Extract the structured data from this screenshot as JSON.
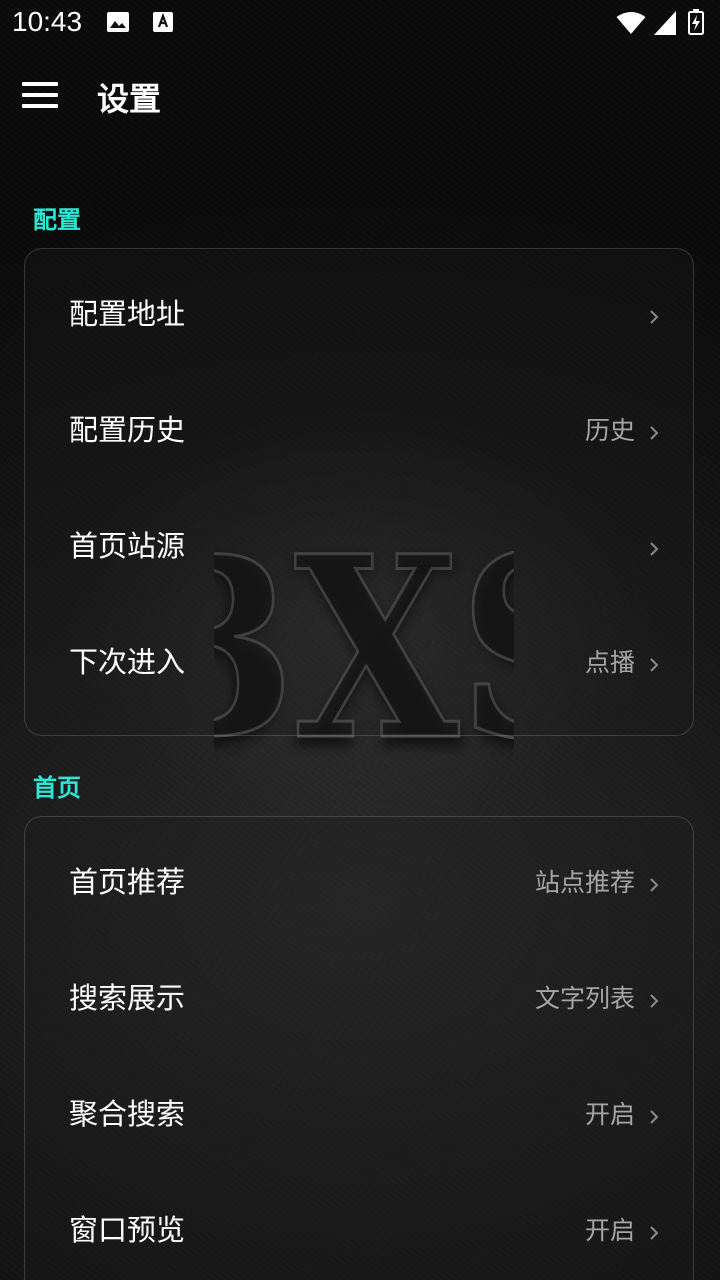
{
  "status_bar": {
    "time": "10:43",
    "icons": [
      "gallery-icon",
      "a-icon",
      "wifi-icon",
      "signal-icon",
      "battery-charging-icon"
    ]
  },
  "app_bar": {
    "menu_icon": "menu-icon",
    "title": "设置"
  },
  "watermark": {
    "text": "BXS"
  },
  "sections": [
    {
      "title": "配置",
      "items": [
        {
          "label": "配置地址",
          "value": ""
        },
        {
          "label": "配置历史",
          "value": "历史"
        },
        {
          "label": "首页站源",
          "value": ""
        },
        {
          "label": "下次进入",
          "value": "点播"
        }
      ]
    },
    {
      "title": "首页",
      "items": [
        {
          "label": "首页推荐",
          "value": "站点推荐"
        },
        {
          "label": "搜索展示",
          "value": "文字列表"
        },
        {
          "label": "聚合搜索",
          "value": "开启"
        },
        {
          "label": "窗口预览",
          "value": "开启"
        }
      ]
    }
  ],
  "colors": {
    "section_title": "#2ee6d6",
    "value_text": "#a6a6a6",
    "background": "#161616"
  }
}
